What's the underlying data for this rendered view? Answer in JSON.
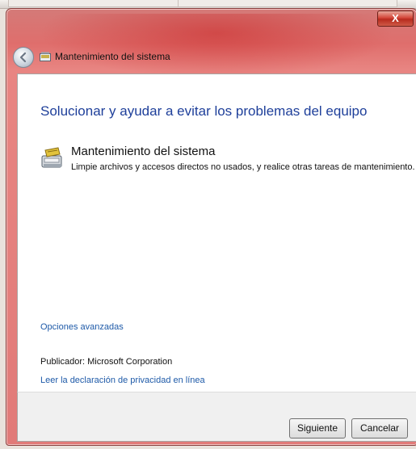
{
  "window": {
    "title": "Mantenimiento del sistema",
    "close_label": "X",
    "accent_color": "#1e3f9a",
    "frame_color": "#e17a78"
  },
  "main": {
    "heading": "Solucionar y ayudar a evitar los problemas del equipo",
    "task": {
      "title": "Mantenimiento del sistema",
      "description": "Limpie archivos y accesos directos no usados, y realice otras tareas de mantenimiento.",
      "icon": "maintenance-icon"
    },
    "advanced_link": "Opciones avanzadas",
    "publisher": "Publicador:  Microsoft Corporation",
    "privacy_link": "Leer la declaración de privacidad en línea"
  },
  "buttons": {
    "next": "Siguiente",
    "cancel": "Cancelar"
  },
  "icons": {
    "back": "back-arrow-icon",
    "title": "maintenance-icon"
  }
}
